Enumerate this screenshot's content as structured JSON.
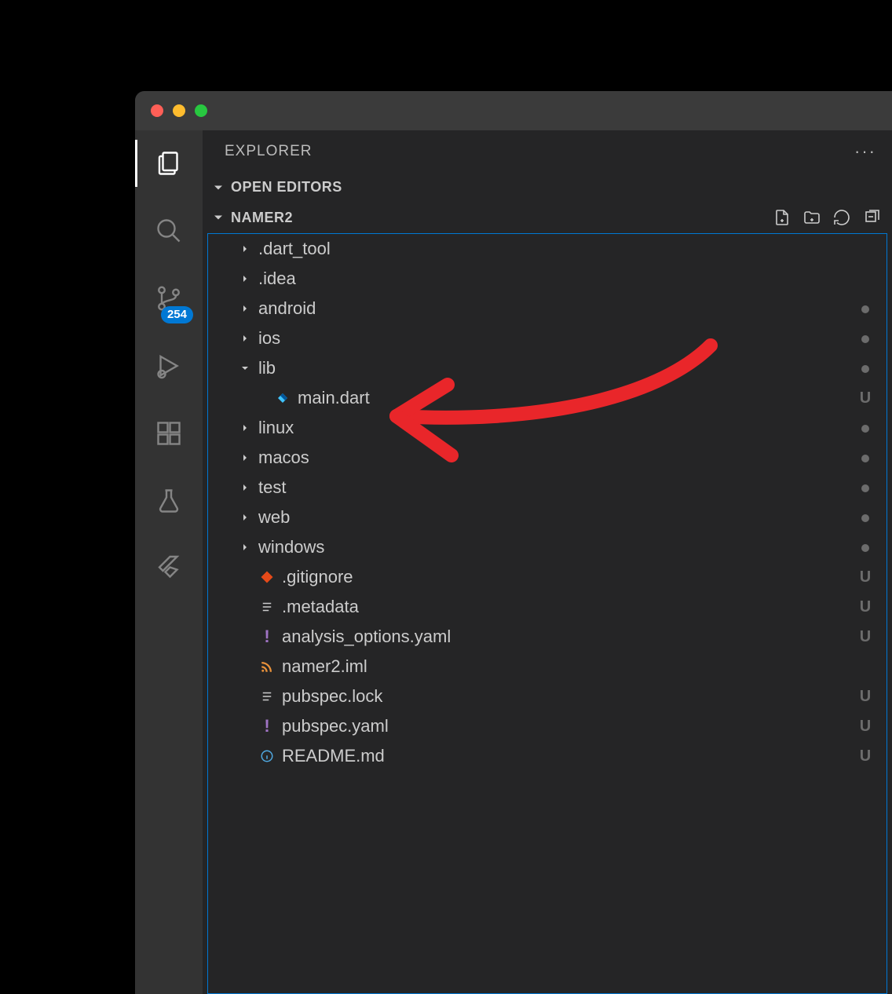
{
  "sidebar": {
    "title": "EXPLORER",
    "sections": {
      "open_editors": "OPEN EDITORS",
      "project": "NAMER2"
    }
  },
  "activity": {
    "scm_badge": "254"
  },
  "tree": [
    {
      "name": ".dart_tool",
      "type": "folder",
      "chev": "right",
      "indent": 1,
      "decoration": ""
    },
    {
      "name": ".idea",
      "type": "folder",
      "chev": "right",
      "indent": 1,
      "decoration": ""
    },
    {
      "name": "android",
      "type": "folder",
      "chev": "right",
      "indent": 1,
      "decoration": "dot"
    },
    {
      "name": "ios",
      "type": "folder",
      "chev": "right",
      "indent": 1,
      "decoration": "dot"
    },
    {
      "name": "lib",
      "type": "folder",
      "chev": "down",
      "indent": 1,
      "decoration": "dot"
    },
    {
      "name": "main.dart",
      "type": "file",
      "icon": "dart",
      "indent": 2,
      "decoration": "U"
    },
    {
      "name": "linux",
      "type": "folder",
      "chev": "right",
      "indent": 1,
      "decoration": "dot"
    },
    {
      "name": "macos",
      "type": "folder",
      "chev": "right",
      "indent": 1,
      "decoration": "dot"
    },
    {
      "name": "test",
      "type": "folder",
      "chev": "right",
      "indent": 1,
      "decoration": "dot"
    },
    {
      "name": "web",
      "type": "folder",
      "chev": "right",
      "indent": 1,
      "decoration": "dot"
    },
    {
      "name": "windows",
      "type": "folder",
      "chev": "right",
      "indent": 1,
      "decoration": "dot"
    },
    {
      "name": ".gitignore",
      "type": "file",
      "icon": "git",
      "indent": 1,
      "decoration": "U"
    },
    {
      "name": ".metadata",
      "type": "file",
      "icon": "lines",
      "indent": 1,
      "decoration": "U"
    },
    {
      "name": "analysis_options.yaml",
      "type": "file",
      "icon": "bang",
      "indent": 1,
      "decoration": "U"
    },
    {
      "name": "namer2.iml",
      "type": "file",
      "icon": "rss",
      "indent": 1,
      "decoration": ""
    },
    {
      "name": "pubspec.lock",
      "type": "file",
      "icon": "lines",
      "indent": 1,
      "decoration": "U"
    },
    {
      "name": "pubspec.yaml",
      "type": "file",
      "icon": "bang",
      "indent": 1,
      "decoration": "U"
    },
    {
      "name": "README.md",
      "type": "file",
      "icon": "info",
      "indent": 1,
      "decoration": "U"
    }
  ]
}
